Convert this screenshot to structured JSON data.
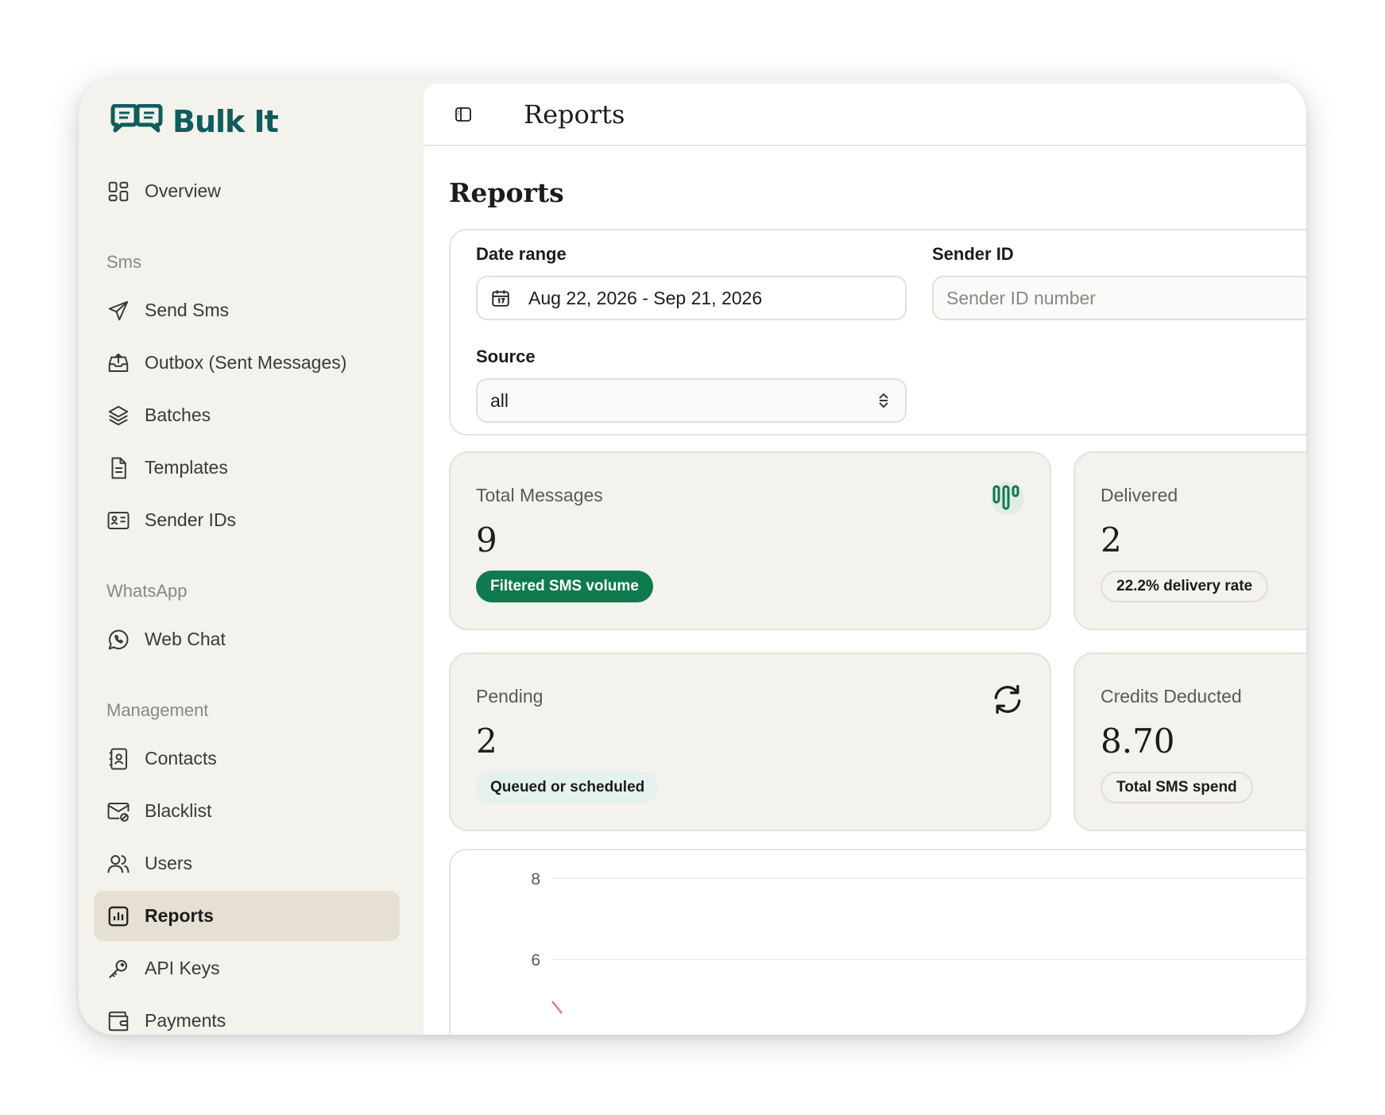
{
  "brand": {
    "name": "Bulk It",
    "color": "#0f5c5b"
  },
  "sidebar": {
    "overview": "Overview",
    "sections": [
      {
        "title": "Sms",
        "items": [
          "Send Sms",
          "Outbox (Sent Messages)",
          "Batches",
          "Templates",
          "Sender IDs"
        ]
      },
      {
        "title": "WhatsApp",
        "items": [
          "Web Chat"
        ]
      },
      {
        "title": "Management",
        "items": [
          "Contacts",
          "Blacklist",
          "Users",
          "Reports",
          "API Keys",
          "Payments"
        ]
      }
    ],
    "active_item": "Reports"
  },
  "header": {
    "title": "Reports"
  },
  "main": {
    "title": "Reports",
    "filters": {
      "date_label": "Date range",
      "date_value": "Aug 22, 2026 - Sep 21, 2026",
      "sender_label": "Sender ID",
      "sender_placeholder": "Sender ID number",
      "source_label": "Source",
      "source_value": "all"
    },
    "cards": {
      "total": {
        "label": "Total Messages",
        "value": "9",
        "badge": "Filtered SMS volume"
      },
      "delivered": {
        "label": "Delivered",
        "value": "2",
        "badge": "22.2% delivery rate"
      },
      "pending": {
        "label": "Pending",
        "value": "2",
        "badge": "Queued or scheduled"
      },
      "credits": {
        "label": "Credits Deducted",
        "value": "8.70",
        "badge": "Total SMS spend"
      }
    }
  },
  "chart_data": {
    "type": "line",
    "title": "",
    "xlabel": "",
    "ylabel": "",
    "yticks": [
      8,
      6
    ],
    "series": [],
    "series_color": "#e87a7a"
  }
}
